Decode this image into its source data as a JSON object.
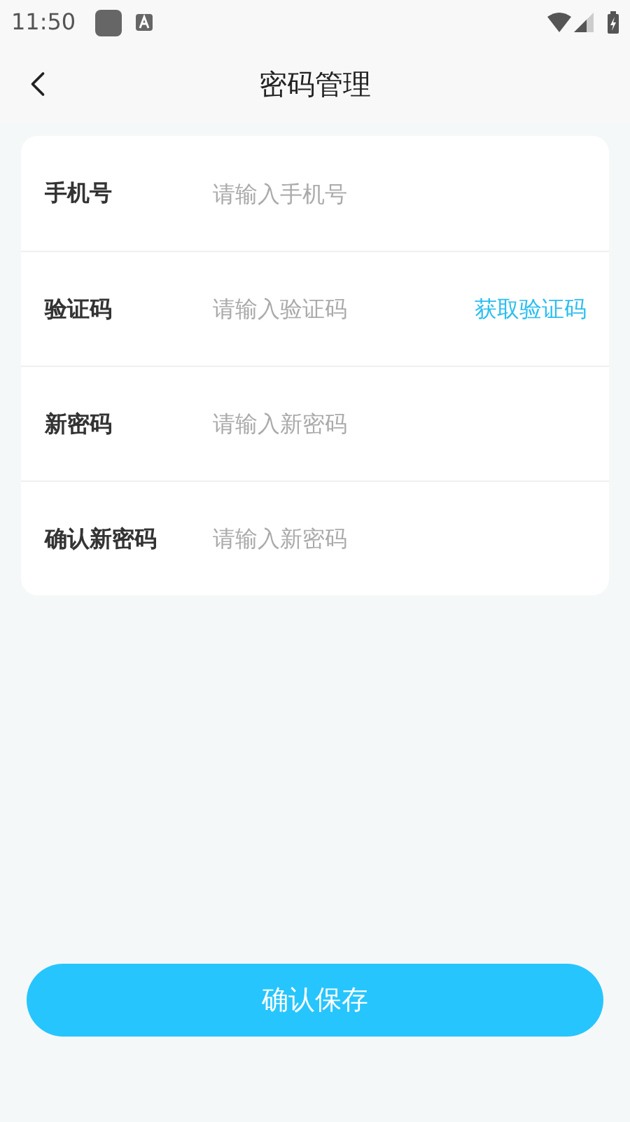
{
  "status_bar": {
    "time": "11:50"
  },
  "header": {
    "title": "密码管理"
  },
  "fields": [
    {
      "kind": "input",
      "label": "手机号",
      "placeholder": "请输入手机号"
    },
    {
      "kind": "input_with_action",
      "label": "验证码",
      "placeholder": "请输入验证码",
      "action": "获取验证码"
    },
    {
      "kind": "input",
      "label": "新密码",
      "placeholder": "请输入新密码"
    },
    {
      "kind": "input",
      "label": "确认新密码",
      "placeholder": "请输入新密码"
    }
  ],
  "submit_button": "确认保存"
}
